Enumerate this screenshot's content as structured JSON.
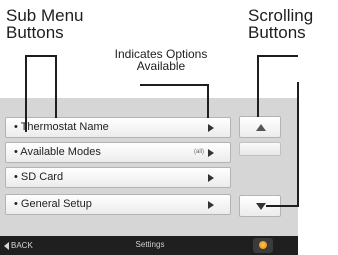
{
  "annotations": {
    "sub_menu_buttons": [
      "Sub Menu",
      "Buttons"
    ],
    "scrolling_buttons": [
      "Scrolling",
      "Buttons"
    ],
    "indicates_options": [
      "Indicates Options",
      "Available"
    ]
  },
  "menu": {
    "items": [
      {
        "label": "• Thermostat Name",
        "has_submenu": true
      },
      {
        "label": "• Available Modes",
        "has_submenu": true,
        "tag": "(all)"
      },
      {
        "label": "• SD Card",
        "has_submenu": true
      },
      {
        "label": "• General Setup",
        "has_submenu": true
      }
    ]
  },
  "scroll": {
    "up_icon": "scroll-up-icon",
    "down_icon": "scroll-down-icon"
  },
  "bottom_bar": {
    "back_label": "BACK",
    "title": "Settings",
    "home_icon": "home-icon"
  },
  "colors": {
    "screen_bg": "#d6d6d6",
    "bar_bg": "#1f1f1f",
    "callout_line": "#1e1e1e"
  }
}
